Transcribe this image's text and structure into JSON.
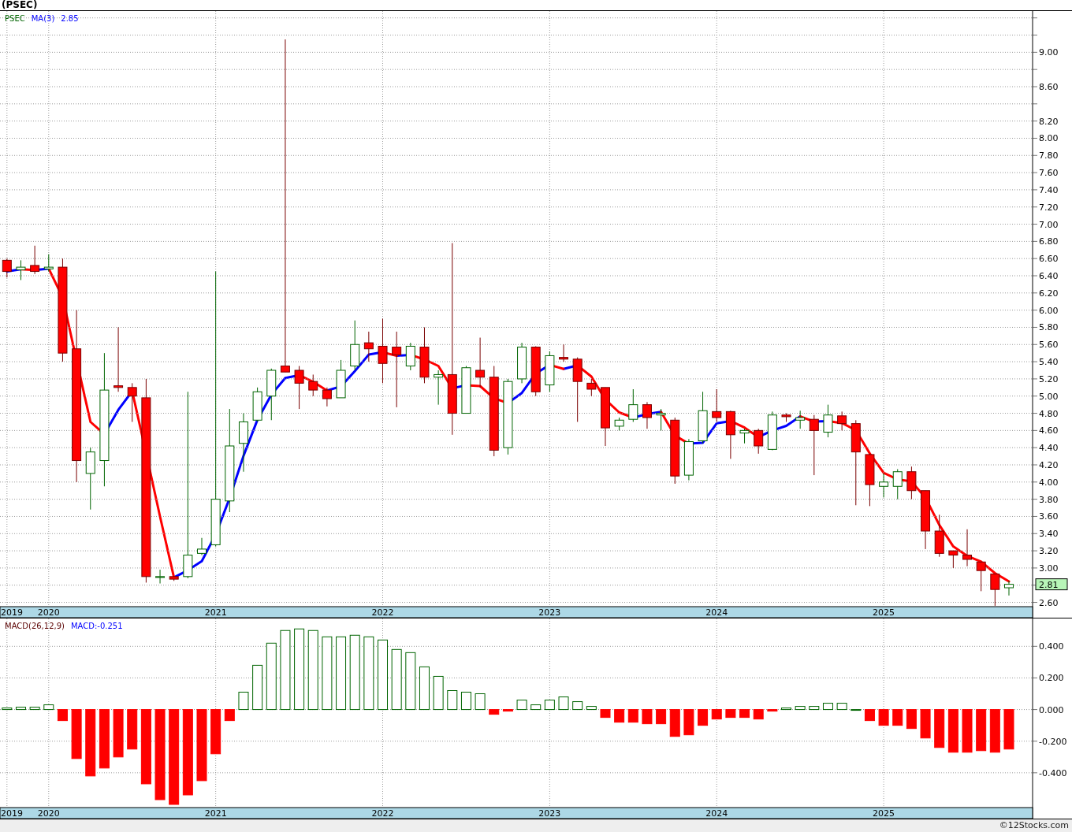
{
  "title": "(PSEC)",
  "price_panel": {
    "legend": {
      "symbol": "PSEC",
      "indicator": "MA(3)",
      "indicator_value": "2.85"
    },
    "last_price": "2.81",
    "chart_data": {
      "type": "candlestick",
      "grid": true,
      "ylim": [
        2.55,
        9.48
      ],
      "yticks": [
        {
          "value": 9,
          "label": "9.00"
        },
        {
          "value": 8.6,
          "label": "8.60"
        },
        {
          "value": 8.2,
          "label": "8.20"
        },
        {
          "value": 8,
          "label": "8.00"
        },
        {
          "value": 7.8,
          "label": "7.80"
        },
        {
          "value": 7.6,
          "label": "7.60"
        },
        {
          "value": 7.4,
          "label": "7.40"
        },
        {
          "value": 7.2,
          "label": "7.20"
        },
        {
          "value": 7,
          "label": "7.00"
        },
        {
          "value": 6.8,
          "label": "6.80"
        },
        {
          "value": 6.6,
          "label": "6.60"
        },
        {
          "value": 6.4,
          "label": "6.40"
        },
        {
          "value": 6.2,
          "label": "6.20"
        },
        {
          "value": 6,
          "label": "6.00"
        },
        {
          "value": 5.8,
          "label": "5.80"
        },
        {
          "value": 5.6,
          "label": "5.60"
        },
        {
          "value": 5.4,
          "label": "5.40"
        },
        {
          "value": 5.2,
          "label": "5.20"
        },
        {
          "value": 5,
          "label": "5.00"
        },
        {
          "value": 4.8,
          "label": "4.80"
        },
        {
          "value": 4.6,
          "label": "4.60"
        },
        {
          "value": 4.4,
          "label": "4.40"
        },
        {
          "value": 4.2,
          "label": "4.20"
        },
        {
          "value": 4,
          "label": "4.00"
        },
        {
          "value": 3.8,
          "label": "3.80"
        },
        {
          "value": 3.6,
          "label": "3.60"
        },
        {
          "value": 3.4,
          "label": "3.40"
        },
        {
          "value": 3.2,
          "label": "3.20"
        },
        {
          "value": 3,
          "label": "3.00"
        },
        {
          "value": 2.6,
          "label": "2.60"
        }
      ],
      "categories": [
        "2019",
        null,
        null,
        "2020",
        null,
        null,
        null,
        null,
        null,
        null,
        null,
        null,
        null,
        null,
        null,
        "2021",
        null,
        null,
        null,
        null,
        null,
        null,
        null,
        null,
        null,
        null,
        null,
        "2022",
        null,
        null,
        null,
        null,
        null,
        null,
        null,
        null,
        null,
        null,
        null,
        "2023",
        null,
        null,
        null,
        null,
        null,
        null,
        null,
        null,
        null,
        null,
        null,
        "2024",
        null,
        null,
        null,
        null,
        null,
        null,
        null,
        null,
        null,
        null,
        null,
        "2025",
        null,
        null,
        null,
        null,
        null,
        null,
        null,
        null,
        null
      ],
      "ohlc": [
        [
          6.58,
          6.6,
          6.38,
          6.45
        ],
        [
          6.47,
          6.58,
          6.35,
          6.5
        ],
        [
          6.52,
          6.75,
          6.42,
          6.45
        ],
        [
          6.48,
          6.65,
          6.45,
          6.5
        ],
        [
          6.5,
          6.6,
          5.4,
          5.5
        ],
        [
          5.55,
          6.0,
          4.0,
          4.25
        ],
        [
          4.1,
          4.4,
          3.68,
          4.35
        ],
        [
          4.25,
          5.5,
          3.95,
          5.07
        ],
        [
          5.12,
          5.8,
          5.05,
          5.1
        ],
        [
          5.1,
          5.15,
          4.7,
          5.0
        ],
        [
          4.98,
          5.2,
          2.83,
          2.9
        ],
        [
          2.89,
          2.98,
          2.82,
          2.9
        ],
        [
          2.9,
          2.9,
          2.85,
          2.87
        ],
        [
          2.9,
          5.05,
          2.88,
          3.15
        ],
        [
          3.17,
          3.35,
          3.15,
          3.22
        ],
        [
          3.27,
          6.45,
          3.25,
          3.8
        ],
        [
          3.78,
          4.85,
          3.65,
          4.42
        ],
        [
          4.45,
          4.8,
          4.12,
          4.7
        ],
        [
          4.72,
          5.1,
          4.7,
          5.05
        ],
        [
          5.0,
          5.32,
          4.72,
          5.3
        ],
        [
          5.35,
          9.15,
          5.28,
          5.28
        ],
        [
          5.3,
          5.35,
          4.85,
          5.15
        ],
        [
          5.17,
          5.25,
          5.0,
          5.07
        ],
        [
          5.07,
          5.1,
          4.88,
          4.97
        ],
        [
          4.98,
          5.42,
          4.98,
          5.3
        ],
        [
          5.35,
          5.88,
          5.3,
          5.6
        ],
        [
          5.62,
          5.75,
          5.4,
          5.55
        ],
        [
          5.58,
          5.9,
          5.15,
          5.38
        ],
        [
          5.57,
          5.75,
          4.87,
          5.48
        ],
        [
          5.35,
          5.62,
          5.3,
          5.58
        ],
        [
          5.57,
          5.8,
          5.15,
          5.22
        ],
        [
          5.22,
          5.3,
          4.9,
          5.25
        ],
        [
          5.25,
          6.78,
          4.55,
          4.8
        ],
        [
          4.8,
          5.35,
          4.8,
          5.33
        ],
        [
          5.3,
          5.68,
          5.1,
          5.22
        ],
        [
          5.22,
          5.35,
          4.3,
          4.37
        ],
        [
          4.4,
          5.2,
          4.32,
          5.17
        ],
        [
          5.2,
          5.62,
          5.15,
          5.57
        ],
        [
          5.57,
          5.58,
          5.0,
          5.05
        ],
        [
          5.13,
          5.52,
          5.05,
          5.47
        ],
        [
          5.45,
          5.6,
          5.4,
          5.43
        ],
        [
          5.43,
          5.45,
          4.7,
          5.17
        ],
        [
          5.15,
          5.2,
          5.0,
          5.08
        ],
        [
          5.1,
          5.1,
          4.42,
          4.63
        ],
        [
          4.65,
          4.75,
          4.6,
          4.72
        ],
        [
          4.73,
          5.08,
          4.7,
          4.9
        ],
        [
          4.9,
          4.93,
          4.62,
          4.75
        ],
        [
          4.78,
          4.85,
          4.6,
          4.8
        ],
        [
          4.72,
          4.75,
          3.98,
          4.07
        ],
        [
          4.08,
          4.5,
          4.02,
          4.47
        ],
        [
          4.48,
          5.05,
          4.45,
          4.83
        ],
        [
          4.82,
          5.08,
          4.7,
          4.75
        ],
        [
          4.82,
          4.83,
          4.27,
          4.55
        ],
        [
          4.57,
          4.62,
          4.45,
          4.6
        ],
        [
          4.6,
          4.62,
          4.33,
          4.42
        ],
        [
          4.38,
          4.82,
          4.37,
          4.78
        ],
        [
          4.78,
          4.8,
          4.7,
          4.76
        ],
        [
          4.72,
          4.83,
          4.62,
          4.75
        ],
        [
          4.73,
          4.78,
          4.08,
          4.6
        ],
        [
          4.58,
          4.9,
          4.52,
          4.78
        ],
        [
          4.77,
          4.82,
          4.6,
          4.68
        ],
        [
          4.68,
          4.72,
          3.73,
          4.35
        ],
        [
          4.32,
          4.33,
          3.72,
          3.97
        ],
        [
          3.95,
          4.1,
          3.82,
          4.0
        ],
        [
          3.95,
          4.15,
          3.8,
          4.12
        ],
        [
          4.12,
          4.18,
          3.8,
          3.9
        ],
        [
          3.9,
          3.9,
          3.22,
          3.43
        ],
        [
          3.43,
          3.62,
          3.13,
          3.17
        ],
        [
          3.2,
          3.2,
          3.0,
          3.15
        ],
        [
          3.15,
          3.45,
          3.02,
          3.1
        ],
        [
          3.07,
          3.07,
          2.73,
          2.97
        ],
        [
          2.93,
          2.93,
          2.56,
          2.75
        ],
        [
          2.77,
          2.85,
          2.68,
          2.81
        ]
      ]
    }
  },
  "macd_panel": {
    "legend": {
      "indicator": "MACD(26,12,9)",
      "reading": "MACD:-0.251"
    },
    "chart_data": {
      "type": "bar",
      "grid": true,
      "ylim": [
        -0.62,
        0.576
      ],
      "yticks": [
        {
          "value": 0.4,
          "label": "0.400"
        },
        {
          "value": 0.2,
          "label": "0.200"
        },
        {
          "value": 0,
          "label": "0.000"
        },
        {
          "value": -0.2,
          "label": "-0.200"
        },
        {
          "value": -0.4,
          "label": "-0.400"
        }
      ],
      "categories": [
        "2019",
        null,
        null,
        "2020",
        null,
        null,
        null,
        null,
        null,
        null,
        null,
        null,
        null,
        null,
        null,
        "2021",
        null,
        null,
        null,
        null,
        null,
        null,
        null,
        null,
        null,
        null,
        null,
        "2022",
        null,
        null,
        null,
        null,
        null,
        null,
        null,
        null,
        null,
        null,
        null,
        "2023",
        null,
        null,
        null,
        null,
        null,
        null,
        null,
        null,
        null,
        null,
        null,
        "2024",
        null,
        null,
        null,
        null,
        null,
        null,
        null,
        null,
        null,
        null,
        null,
        "2025",
        null,
        null,
        null,
        null,
        null,
        null,
        null,
        null,
        null
      ],
      "values": [
        0.01,
        0.015,
        0.015,
        0.03,
        -0.07,
        -0.31,
        -0.42,
        -0.37,
        -0.3,
        -0.25,
        -0.47,
        -0.57,
        -0.6,
        -0.54,
        -0.45,
        -0.28,
        -0.07,
        0.11,
        0.28,
        0.42,
        0.5,
        0.51,
        0.5,
        0.46,
        0.46,
        0.47,
        0.46,
        0.44,
        0.38,
        0.36,
        0.27,
        0.21,
        0.12,
        0.11,
        0.1,
        -0.03,
        -0.01,
        0.06,
        0.03,
        0.06,
        0.08,
        0.05,
        0.02,
        -0.05,
        -0.08,
        -0.08,
        -0.09,
        -0.09,
        -0.17,
        -0.16,
        -0.1,
        -0.06,
        -0.05,
        -0.05,
        -0.06,
        -0.01,
        0.01,
        0.02,
        0.02,
        0.04,
        0.04,
        0.0,
        -0.07,
        -0.1,
        -0.1,
        -0.12,
        -0.18,
        -0.24,
        -0.27,
        -0.27,
        -0.26,
        -0.27,
        -0.25
      ]
    }
  },
  "footer": "©12Stocks.com"
}
